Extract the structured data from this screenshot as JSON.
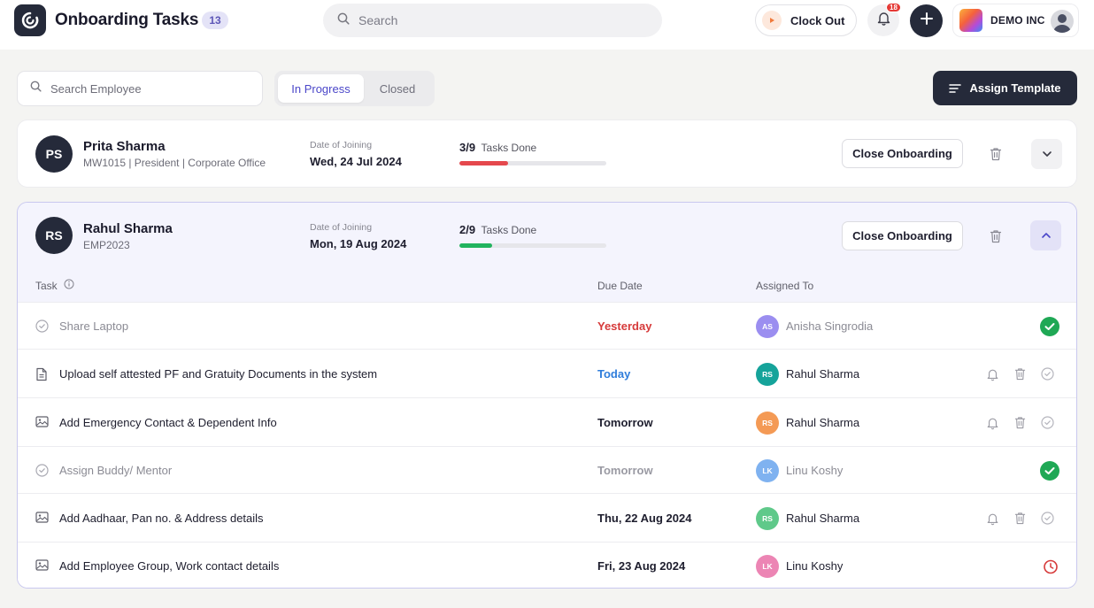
{
  "header": {
    "title": "Onboarding Tasks",
    "count": "13",
    "search_placeholder": "Search",
    "clock_out_label": "Clock Out",
    "notification_count": "18",
    "company_name": "DEMO INC"
  },
  "toolbar": {
    "employee_search_placeholder": "Search Employee",
    "tabs": [
      {
        "label": "In Progress",
        "active": true
      },
      {
        "label": "Closed",
        "active": false
      }
    ],
    "assign_template_label": "Assign Template"
  },
  "employees": [
    {
      "initials": "PS",
      "name": "Prita Sharma",
      "meta": "MW1015 | President | Corporate Office",
      "doj_label": "Date of Joining",
      "doj": "Wed, 24 Jul 2024",
      "tasks_fraction": "3/9",
      "tasks_label": "Tasks Done",
      "progress": 0.333,
      "progress_color": "#e5484d",
      "close_label": "Close Onboarding",
      "expanded": false
    },
    {
      "initials": "RS",
      "name": "Rahul Sharma",
      "meta": "EMP2023",
      "doj_label": "Date of Joining",
      "doj": "Mon, 19 Aug 2024",
      "tasks_fraction": "2/9",
      "tasks_label": "Tasks Done",
      "progress": 0.222,
      "progress_color": "#22b35e",
      "close_label": "Close Onboarding",
      "expanded": true
    }
  ],
  "task_table": {
    "columns": [
      "Task",
      "Due Date",
      "Assigned To"
    ],
    "rows": [
      {
        "icon": "check-circle-icon",
        "task": "Share Laptop",
        "due": "Yesterday",
        "due_color": "#d63a3a",
        "assignee_initials": "AS",
        "assignee": "Anisha Singrodia",
        "avatar_color": "#9b8ef0",
        "status": "done"
      },
      {
        "icon": "document-icon",
        "task": "Upload self attested PF and Gratuity Documents in the system",
        "due": "Today",
        "due_color": "#2f7ddb",
        "assignee_initials": "RS",
        "assignee": "Rahul Sharma",
        "avatar_color": "#15a39a",
        "status": "pending"
      },
      {
        "icon": "image-icon",
        "task": "Add Emergency Contact & Dependent Info",
        "due": "Tomorrow",
        "due_color": "#1e1e2e",
        "assignee_initials": "RS",
        "assignee": "Rahul Sharma",
        "avatar_color": "#f49a55",
        "status": "pending"
      },
      {
        "icon": "check-circle-icon",
        "task": "Assign Buddy/ Mentor",
        "due": "Tomorrow",
        "due_color": "#9a9aa3",
        "assignee_initials": "LK",
        "assignee": "Linu Koshy",
        "avatar_color": "#7fb2f0",
        "status": "done"
      },
      {
        "icon": "image-icon",
        "task": "Add Aadhaar, Pan no. & Address details",
        "due": "Thu, 22 Aug 2024",
        "due_color": "#1e1e2e",
        "assignee_initials": "RS",
        "assignee": "Rahul Sharma",
        "avatar_color": "#5fc98a",
        "status": "pending"
      },
      {
        "icon": "image-icon",
        "task": "Add Employee Group, Work contact details",
        "due": "Fri, 23 Aug 2024",
        "due_color": "#1e1e2e",
        "assignee_initials": "LK",
        "assignee": "Linu Koshy",
        "avatar_color": "#ec85b4",
        "status": "overdue"
      }
    ]
  }
}
